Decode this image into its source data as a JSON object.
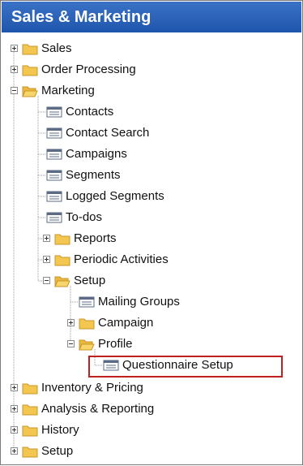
{
  "window": {
    "title": "Sales & Marketing"
  },
  "tree": {
    "items": [
      {
        "label": "Sales",
        "type": "folder",
        "state": "collapsed"
      },
      {
        "label": "Order Processing",
        "type": "folder",
        "state": "collapsed"
      },
      {
        "label": "Marketing",
        "type": "folder",
        "state": "expanded"
      },
      {
        "label": "Contacts",
        "type": "form"
      },
      {
        "label": "Contact Search",
        "type": "form"
      },
      {
        "label": "Campaigns",
        "type": "form"
      },
      {
        "label": "Segments",
        "type": "form"
      },
      {
        "label": "Logged Segments",
        "type": "form"
      },
      {
        "label": "To-dos",
        "type": "form"
      },
      {
        "label": "Reports",
        "type": "folder",
        "state": "collapsed"
      },
      {
        "label": "Periodic Activities",
        "type": "folder",
        "state": "collapsed"
      },
      {
        "label": "Setup",
        "type": "folder",
        "state": "expanded"
      },
      {
        "label": "Mailing Groups",
        "type": "form"
      },
      {
        "label": "Campaign",
        "type": "folder",
        "state": "collapsed"
      },
      {
        "label": "Profile",
        "type": "folder",
        "state": "expanded"
      },
      {
        "label": "Questionnaire Setup",
        "type": "form",
        "highlighted": true
      },
      {
        "label": "Inventory & Pricing",
        "type": "folder",
        "state": "collapsed"
      },
      {
        "label": "Analysis & Reporting",
        "type": "folder",
        "state": "collapsed"
      },
      {
        "label": "History",
        "type": "folder",
        "state": "collapsed"
      },
      {
        "label": "Setup",
        "type": "folder",
        "state": "collapsed"
      }
    ]
  },
  "colors": {
    "title_bar": "#2a62b8",
    "folder": "#f3c64f",
    "highlight_border": "#c0201f"
  },
  "icons": {
    "folder": "folder-icon",
    "form": "form-icon"
  }
}
